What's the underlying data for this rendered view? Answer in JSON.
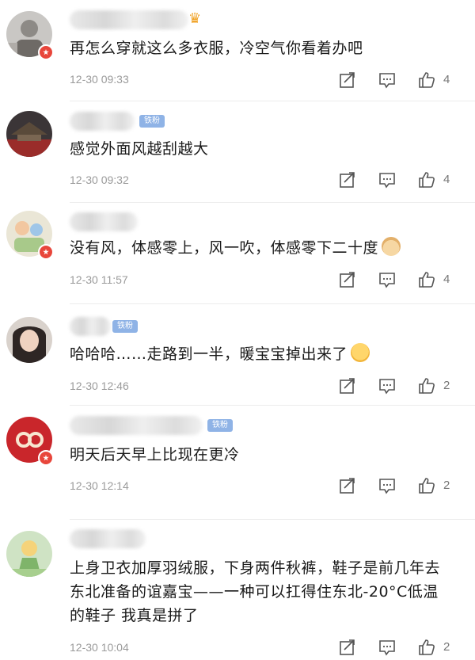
{
  "colors": {
    "background": "#ffffff",
    "text": "#1a1a1a",
    "meta": "#9a9a9a",
    "fan_tag": "#8fb3e6",
    "badge_red": "#e8463b",
    "divider": "#ececec"
  },
  "comments": [
    {
      "text": "再怎么穿就这么多衣服，冷空气你看着办吧",
      "time": "12-30 09:33",
      "likes": "4",
      "fan_tag": "",
      "badge": true,
      "crown": true,
      "emoji": ""
    },
    {
      "text": "感觉外面风越刮越大",
      "time": "12-30 09:32",
      "likes": "4",
      "fan_tag": "铁粉",
      "badge": false,
      "crown": false,
      "emoji": ""
    },
    {
      "text": "没有风，体感零上，风一吹，体感零下二十度",
      "time": "12-30 11:57",
      "likes": "4",
      "fan_tag": "",
      "badge": true,
      "crown": false,
      "emoji": "doge-emoji"
    },
    {
      "text": "哈哈哈……走路到一半，暖宝宝掉出来了",
      "time": "12-30 12:46",
      "likes": "2",
      "fan_tag": "铁粉",
      "badge": false,
      "crown": false,
      "emoji": "shy-emoji"
    },
    {
      "text": "明天后天早上比现在更冷",
      "time": "12-30 12:14",
      "likes": "2",
      "fan_tag": "铁粉",
      "badge": true,
      "crown": false,
      "emoji": ""
    },
    {
      "text": "上身卫衣加厚羽绒服，下身两件秋裤，鞋子是前几年去东北准备的谊嘉宝——一种可以扛得住东北-20°C低温的鞋子 我真是拼了",
      "time": "12-30 10:04",
      "likes": "2",
      "fan_tag": "",
      "badge": false,
      "crown": false,
      "emoji": ""
    }
  ],
  "icons": {
    "repost": "repost-icon",
    "reply": "comment-icon",
    "like": "thumbs-up-icon",
    "crown": "crown-icon",
    "badge": "verified-badge-icon"
  }
}
